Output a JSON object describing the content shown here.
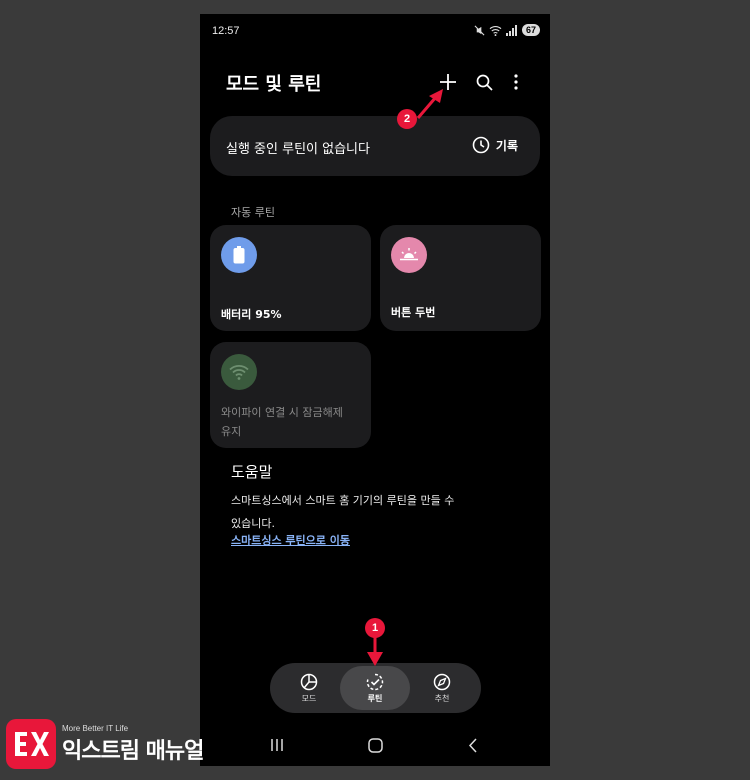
{
  "status_bar": {
    "time": "12:57",
    "battery": "67"
  },
  "header": {
    "title": "모드 및 루틴"
  },
  "running": {
    "text": "실행 중인 루틴이 없습니다",
    "history_label": "기록"
  },
  "auto_routines": {
    "section_label": "자동 루틴",
    "tiles": [
      {
        "label": "배터리 95%",
        "icon": "battery-icon",
        "color": "#6f9cea"
      },
      {
        "label": "버튼 두번",
        "icon": "sunset-icon",
        "color": "#e488ac"
      },
      {
        "label_line1": "와이파이 연결 시 잠금해제",
        "label_line2": "유지",
        "icon": "wifi-icon",
        "color": "#3a5a3d"
      }
    ]
  },
  "help": {
    "title": "도움말",
    "body_line1": "스마트싱스에서 스마트 홈 기기의 루틴을 만들 수",
    "body_line2": "있습니다.",
    "link": "스마트싱스 루틴으로 이동"
  },
  "bottom_nav": {
    "items": [
      {
        "label": "모드",
        "icon": "mode-icon"
      },
      {
        "label": "루틴",
        "icon": "routine-icon",
        "active": true
      },
      {
        "label": "추천",
        "icon": "compass-icon"
      }
    ]
  },
  "annotations": {
    "badge_1": "1",
    "badge_2": "2",
    "accent": "#e8173a"
  },
  "watermark": {
    "tagline": "More Better IT Life",
    "name": "익스트림 매뉴얼",
    "logo_text": "EX"
  }
}
